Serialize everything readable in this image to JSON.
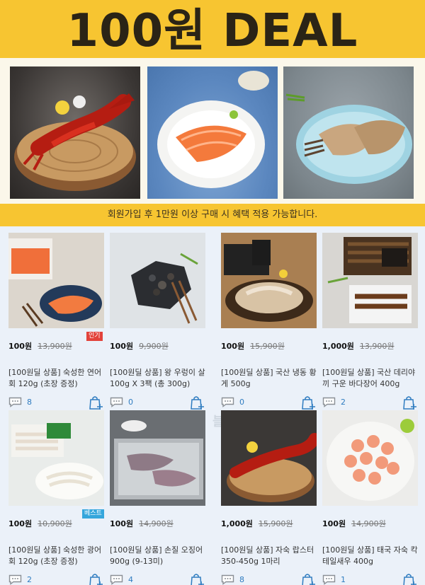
{
  "banner": {
    "title": "100원 DEAL",
    "note": "회원가입 후 1만원 이상 구매 시 혜택 적용 가능합니다.",
    "photos": [
      "lobster-photo",
      "salmon-sashimi-photo",
      "dried-squid-photo"
    ]
  },
  "watermark": "마켓촌 블로그",
  "colors": {
    "banner_bg": "#f7c531",
    "grid_bg": "#ebf1f9",
    "count_blue": "#2f7cc0",
    "badge_red": "#e2423a",
    "badge_blue": "#35a6dc"
  },
  "products": [
    {
      "price": "100원",
      "original_price": "13,900원",
      "badge": "인기",
      "name": "[100원딜 상품] 숙성한 연어회 120g (초장 증정)",
      "reviews": "8"
    },
    {
      "price": "100원",
      "original_price": "9,900원",
      "badge": "",
      "name": "[100원딜 상품] 왕 우렁이 살 100g X 3팩 (총 300g)",
      "reviews": "0"
    },
    {
      "price": "100원",
      "original_price": "15,900원",
      "badge": "",
      "name": "[100원딜 상품] 국산 냉동 황게 500g",
      "reviews": "0"
    },
    {
      "price": "1,000원",
      "original_price": "13,900원",
      "badge": "",
      "name": "[100원딜 상품] 국산 데리야끼 구운 바다장어 400g",
      "reviews": "2"
    },
    {
      "price": "100원",
      "original_price": "10,900원",
      "badge": "베스트",
      "name": "[100원딜 상품] 숙성한 광어회 120g (초장 증정)",
      "reviews": "2"
    },
    {
      "price": "100원",
      "original_price": "14,900원",
      "badge": "",
      "name": "[100원딜 상품] 손질 오징어 900g (9-13미)",
      "reviews": "4"
    },
    {
      "price": "1,000원",
      "original_price": "15,900원",
      "badge": "",
      "name": "[100원딜 상품] 자숙 랍스터 350-450g 1마리",
      "reviews": "8"
    },
    {
      "price": "100원",
      "original_price": "14,900원",
      "badge": "",
      "name": "[100원딜 상품] 태국 자숙 칵테일새우 400g",
      "reviews": "1"
    }
  ]
}
